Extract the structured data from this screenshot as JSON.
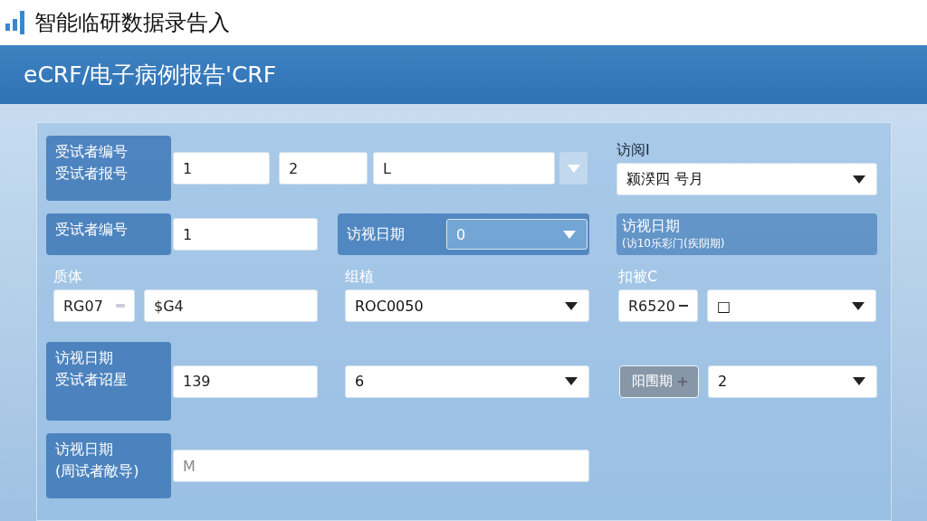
{
  "app": {
    "title": "智能临研数据录告入"
  },
  "header": {
    "title": "eCRF/电子病例报告'CRF"
  },
  "subject_id": {
    "label_lines": [
      "受试者编号",
      "受试者报号"
    ],
    "inputs": [
      {
        "value": "1"
      },
      {
        "value": "2"
      },
      {
        "value": "L"
      }
    ]
  },
  "visit": {
    "label": "访阅I",
    "value": "颍湀四 号月"
  },
  "subject_no": {
    "label": "受试者编号",
    "value": "1"
  },
  "visit_date_select": {
    "label": "访视日期",
    "value": "0"
  },
  "visit_date_note": {
    "label": "访视日期",
    "note": "(访10乐彩门(疾阴期)"
  },
  "substance": {
    "label": "质体",
    "code": "RG07",
    "value": "$G4"
  },
  "group": {
    "label": "组植",
    "value": "ROC0050"
  },
  "scan": {
    "label": "扣被C",
    "code": "R6520",
    "value": "□"
  },
  "visit_date_2": {
    "label_lines": [
      "访视日期",
      "受试者诏星"
    ],
    "value": "139",
    "select": "6",
    "button": "阳围期",
    "select_2": "2"
  },
  "visit_date_3": {
    "label_lines": [
      "访视日期",
      "(周试者敵导)"
    ],
    "placeholder": "M"
  }
}
